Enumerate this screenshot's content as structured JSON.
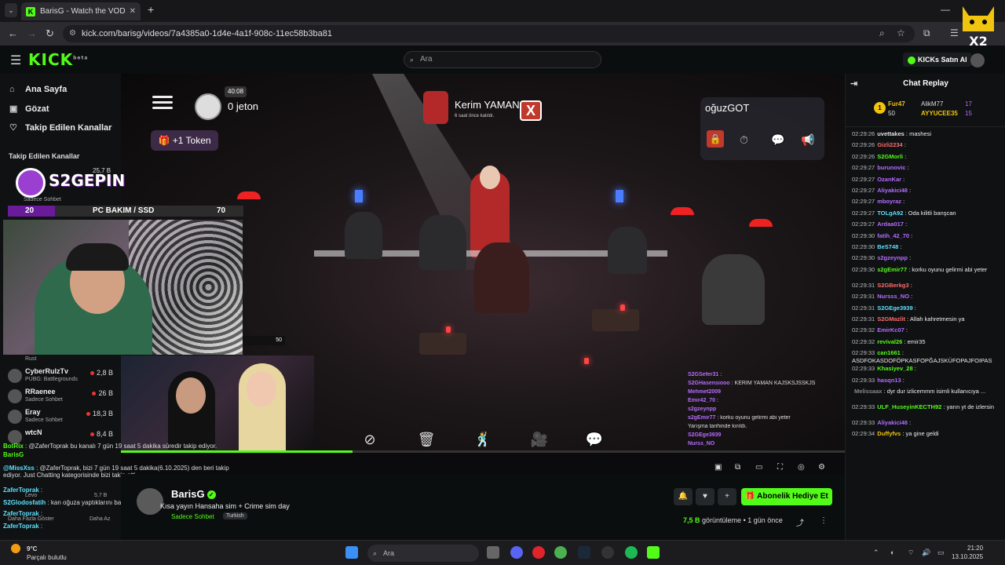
{
  "browser": {
    "tab_title": "BarisG - Watch the VOD on",
    "url": "kick.com/barisg/videos/7a4385a0-1d4e-4a1f-908c-11ec58b3ba81"
  },
  "header": {
    "logo": "KICK",
    "logo_sup": "beta",
    "search_placeholder": "Ara",
    "kicks_label": "KICKs Satın Al",
    "mascot_label": "X2"
  },
  "sidebar": {
    "nav": [
      {
        "label": "Ana Sayfa",
        "icon": "home-icon"
      },
      {
        "label": "Gözat",
        "icon": "browse-icon"
      },
      {
        "label": "Takip Edilen Kanallar",
        "icon": "heart-icon"
      }
    ],
    "followed_title": "Takip Edilen Kanallar",
    "channels": [
      {
        "name": "CyberRulzTv",
        "category": "PUBG: Battlegrounds",
        "viewers": "2,8 B"
      },
      {
        "name": "RRaenee",
        "category": "Sadece Sohbet",
        "viewers": "26 B"
      },
      {
        "name": "Eray",
        "category": "Sadece Sohbet",
        "viewers": "18,3 B"
      },
      {
        "name": "wtcN",
        "category": "",
        "viewers": "8,4 B"
      }
    ],
    "rust_label": "Rust",
    "top_channel_viewers": "25,7 B",
    "top_channel_cat": "Sadece Sohbet"
  },
  "overlay": {
    "brand": "S2GEPIN",
    "pc_left": "20",
    "pc_text": "PC BAKIM / SSD",
    "pc_right": "70",
    "fifty": "50"
  },
  "game_hud": {
    "timer": "40:08",
    "jeton": "0 jeton",
    "token_btn": "+1 Token",
    "kerim_name": "Kerim YAMAN",
    "kerim_sub": "6 saat önce katıldı.",
    "x_label": "X",
    "oguz_name": "oğuzGOT"
  },
  "overlay_chat": [
    {
      "user": "S2GSefer31",
      "text": ":"
    },
    {
      "user": "S2GHasensiooo",
      "text": ": KERİM YAMAN KAJSKSJSSKJS"
    },
    {
      "user": "Mehmet2009",
      "text": ""
    },
    {
      "user": "Emir42_70",
      "text": ":"
    },
    {
      "user": "s2gzeynpp",
      "text": ""
    },
    {
      "user": "s2gEmir77",
      "text": ": korku oyunu gelirmi abi yeter"
    },
    {
      "user": "",
      "text": "Yarışma tarihinde kırıldı."
    },
    {
      "user": "S2GEge3939",
      "text": ""
    },
    {
      "user": "Nurss_NO",
      "text": ""
    }
  ],
  "side_chat": [
    {
      "user": "BotRix",
      "text": ": @ZaferToprak bu kanalı 7 gün 19 saat 5 dakika süredir takip ediyor."
    },
    {
      "user": "BarisG",
      "text": ""
    },
    {
      "user": "@MissXss",
      "text": ": @ZaferToprak, bizi 7 gün 19 saat 5 dakika(6.10.2025) den beri takip ediyor. Just Chatting kategorisinde bizi takip etti."
    },
    {
      "user": "ZaferToprak",
      "text": ":"
    },
    {
      "user": "S2Glodosfatih",
      "text": ": kan oğuza yaptıklarını bana yapsınlar olur mu"
    },
    {
      "user": "ZaferToprak",
      "text": ":"
    },
    {
      "user": "ZaferToprak",
      "text": ":"
    }
  ],
  "side_misc": {
    "levo": "Levo",
    "levo_viewers": "5,7 B",
    "show_more": "Daha Fazla Göster",
    "show_less": "Daha Az"
  },
  "vod": {
    "streamer": "BarisG",
    "title": "Kısa yayın Hansaha sim + Crime sim day",
    "category": "Sadece Sohbet",
    "language": "Turkish",
    "subscribe_gift": "Abonelik Hediye Et",
    "views": "7,5 B",
    "views_label": "görüntüleme",
    "ago": "1 gün önce",
    "progress": 0.32
  },
  "chat": {
    "title": "Chat Replay",
    "leaders": [
      {
        "rank": "1",
        "name": "Fur47",
        "count": "50"
      },
      {
        "name": "AlikM77",
        "count": "17"
      },
      {
        "name": "AYYUCEE35",
        "count": "15"
      }
    ],
    "messages": [
      {
        "ts": "02:29:26",
        "user": "uvettakes",
        "text": ": mashesi",
        "color": "#e1e1e1"
      },
      {
        "ts": "02:29:26",
        "user": "Gizli2234",
        "text": ":",
        "color": "#ff6b6b"
      },
      {
        "ts": "02:29:26",
        "user": "S2GMorli",
        "text": ":",
        "color": "#53fc18"
      },
      {
        "ts": "02:29:27",
        "user": "burunovic",
        "text": ":",
        "color": "#b46cff"
      },
      {
        "ts": "02:29:27",
        "user": "OzanKar",
        "text": ":",
        "color": "#b46cff"
      },
      {
        "ts": "02:29:27",
        "user": "Aliyakici48",
        "text": ":",
        "color": "#b46cff"
      },
      {
        "ts": "02:29:27",
        "user": "mboyraz",
        "text": ":",
        "color": "#b46cff"
      },
      {
        "ts": "02:29:27",
        "user": "TOLgA92",
        "text": ": Oda kilitli banşcan",
        "color": "#5ee2ff"
      },
      {
        "ts": "02:29:27",
        "user": "Ardaa017",
        "text": ":",
        "color": "#b46cff"
      },
      {
        "ts": "02:29:30",
        "user": "fatih_42_70",
        "text": ":",
        "color": "#b46cff"
      },
      {
        "ts": "02:29:30",
        "user": "BeS748",
        "text": ":",
        "color": "#5ee2ff"
      },
      {
        "ts": "02:29:30",
        "user": "s2gzeynpp",
        "text": ":",
        "color": "#b46cff"
      },
      {
        "ts": "02:29:30",
        "user": "s2gEmir77",
        "text": ": korku oyunu gelirmi abi yeter",
        "color": "#53fc18"
      },
      {
        "ts": "02:29:31",
        "user": "S2GBerkg3",
        "text": ":",
        "color": "#ff6b6b"
      },
      {
        "ts": "02:29:31",
        "user": "Nursss_NO",
        "text": ":",
        "color": "#b46cff"
      },
      {
        "ts": "02:29:31",
        "user": "S2GEge3939",
        "text": ":",
        "color": "#5ee2ff"
      },
      {
        "ts": "02:29:31",
        "user": "S2GMazlit",
        "text": ": Allah kahretmesin ya",
        "color": "#ff6b6b"
      },
      {
        "ts": "02:29:32",
        "user": "EmirKc07",
        "text": ":",
        "color": "#b46cff"
      },
      {
        "ts": "02:29:32",
        "user": "revival26",
        "text": ": emir35",
        "color": "#53fc18"
      },
      {
        "ts": "02:29:33",
        "user": "can1661",
        "text": ": ASDFOKASDOFÖPKASFOPĞAJSKÜFOPAJFOIPAS",
        "color": "#53fc18"
      },
      {
        "ts": "02:29:33",
        "user": "Khasiyev_28",
        "text": ":",
        "color": "#53fc18"
      },
      {
        "ts": "02:29:33",
        "user": "hasqn13",
        "text": ":",
        "color": "#b46cff"
      },
      {
        "ts": "",
        "user": "Melissaax",
        "text": ": dyr dur izlicemmm isimli kullanıcıya ...",
        "color": "#888888"
      },
      {
        "ts": "02:29:33",
        "user": "ULF_HuseyinKECTH92",
        "text": ": yarın yt de izlersin",
        "color": "#53fc18"
      },
      {
        "ts": "02:29:33",
        "user": "Aliyakici48",
        "text": ":",
        "color": "#b46cff"
      },
      {
        "ts": "02:29:34",
        "user": "Duffyfvs",
        "text": ": ya gine geldi",
        "color": "#f1c40f"
      }
    ]
  },
  "taskbar": {
    "temp": "9°C",
    "weather": "Parçalı bulutlu",
    "search": "Ara",
    "time": "21:20",
    "date": "13.10.2025"
  }
}
